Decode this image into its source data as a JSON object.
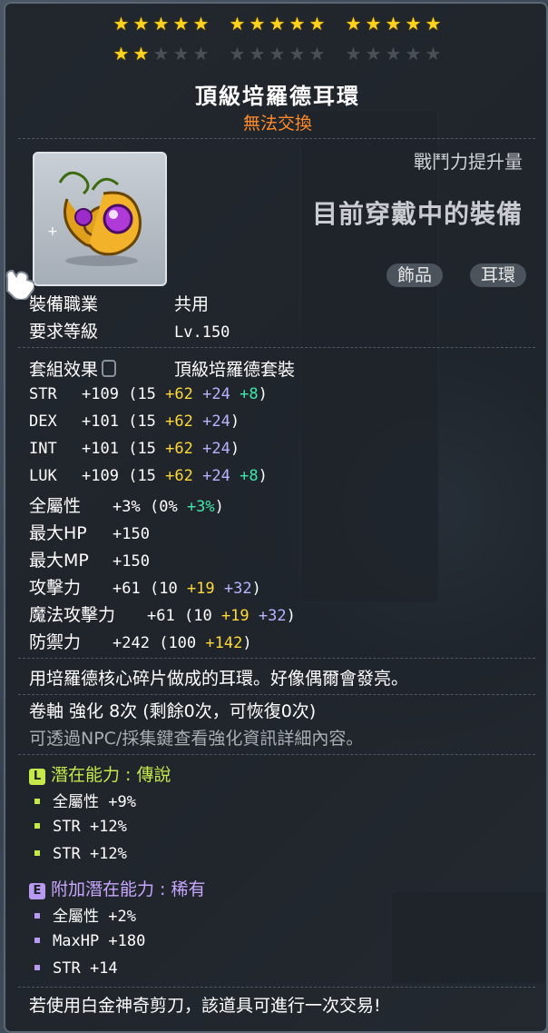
{
  "stars": {
    "rows": [
      [
        [
          1,
          1,
          1,
          1,
          1
        ],
        [
          1,
          1,
          1,
          1,
          1
        ],
        [
          1,
          1,
          1,
          1,
          1
        ]
      ],
      [
        [
          1,
          1,
          0,
          0,
          0
        ],
        [
          0,
          0,
          0,
          0,
          0
        ],
        [
          0,
          0,
          0,
          0,
          0
        ]
      ]
    ]
  },
  "item": {
    "name": "頂級培羅德耳環",
    "trade_status": "無法交換",
    "power_label": "戰鬥力提升量",
    "equipped_label": "目前穿戴中的裝備",
    "tags": [
      "飾品",
      "耳環"
    ],
    "icon": "earring-icon"
  },
  "info": {
    "job_label": "裝備職業",
    "job_value": "共用",
    "level_label": "要求等級",
    "level_value": "Lv.150",
    "set_label": "套組效果",
    "set_value": "頂級培羅德套裝"
  },
  "stats": [
    {
      "name": "STR",
      "total": "+109",
      "open": "(15",
      "a": "+62",
      "b": "+24",
      "c": "+8",
      "close": ")"
    },
    {
      "name": "DEX",
      "total": "+101",
      "open": "(15",
      "a": "+62",
      "b": "+24",
      "c": "",
      "close": ")"
    },
    {
      "name": "INT",
      "total": "+101",
      "open": "(15",
      "a": "+62",
      "b": "+24",
      "c": "",
      "close": ")"
    },
    {
      "name": "LUK",
      "total": "+109",
      "open": "(15",
      "a": "+62",
      "b": "+24",
      "c": "+8",
      "close": ")"
    }
  ],
  "allstat": {
    "name": "全屬性",
    "total": "+3%",
    "open": "(0%",
    "c": "+3%",
    "close": ")"
  },
  "maxhp": {
    "name": "最大HP",
    "total": "+150"
  },
  "maxmp": {
    "name": "最大MP",
    "total": "+150"
  },
  "atk": {
    "name": "攻擊力",
    "total": "+61",
    "open": "(10",
    "a": "+19",
    "b": "+32",
    "close": ")"
  },
  "matk": {
    "name": "魔法攻擊力",
    "total": "+61",
    "open": "(10",
    "a": "+19",
    "b": "+32",
    "close": ")"
  },
  "def": {
    "name": "防禦力",
    "total": "+242",
    "open": "(100",
    "a": "+142",
    "close": ")"
  },
  "description": "用培羅德核心碎片做成的耳環。好像偶爾會發亮。",
  "scroll": "卷軸 強化 8次 (剩餘0次，可恢復0次)",
  "hint": "可透過NPC/採集鍵查看強化資訊詳細內容。",
  "potential": {
    "badge": "L",
    "title": "潛在能力 : 傳說",
    "lines": [
      "全屬性 +9%",
      "STR +12%",
      "STR +12%"
    ]
  },
  "additional": {
    "badge": "E",
    "title": "附加潛在能力 : 稀有",
    "lines": [
      "全屬性 +2%",
      "MaxHP +180",
      "STR +14"
    ]
  },
  "footer": "若使用白金神奇剪刀，該道具可進行一次交易!",
  "colors": {
    "star_on": "#ffd21e",
    "title_orange": "#ff8a2a",
    "legendary": "#c5e84a",
    "rare": "#c8a6ff",
    "bonus_yellow": "#ffd83a",
    "bonus_purple": "#b9b2ff",
    "bonus_green": "#3ee8a8"
  }
}
